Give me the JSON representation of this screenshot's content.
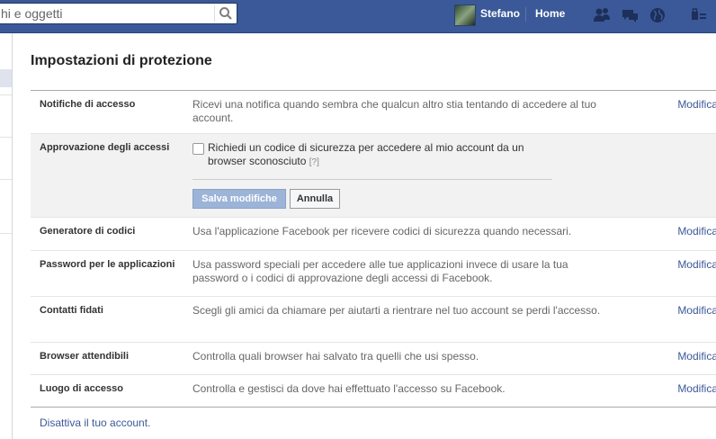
{
  "topbar": {
    "search_placeholder": "hi e oggetti",
    "user_name": "Stefano",
    "home_label": "Home",
    "icons": [
      "friend-requests-icon",
      "messages-icon",
      "notifications-globe-icon",
      "account-menu-icon"
    ]
  },
  "page": {
    "title": "Impostazioni di protezione",
    "rows": [
      {
        "label": "Notifiche di accesso",
        "description": "Ricevi una notifica quando sembra che qualcun altro stia tentando di accedere al tuo account.",
        "edit": "Modifica"
      },
      {
        "label": "Approvazione degli accessi",
        "checkbox_text": "Richiedi un codice di sicurezza per accedere al mio account da un browser sconosciuto",
        "help": "[?]",
        "save_button": "Salva modifiche",
        "cancel_button": "Annulla",
        "checked": false
      },
      {
        "label": "Generatore di codici",
        "description": "Usa l'applicazione Facebook per ricevere codici di sicurezza quando necessari.",
        "edit": "Modifica"
      },
      {
        "label": "Password per le applicazioni",
        "description": "Usa password speciali per accedere alle tue applicazioni invece di usare la tua password o i codici di approvazione degli accessi di Facebook.",
        "edit": "Modifica"
      },
      {
        "label": "Contatti fidati",
        "description": "Scegli gli amici da chiamare per aiutarti a rientrare nel tuo account se perdi l'accesso.",
        "edit": "Modifica"
      },
      {
        "label": "Browser attendibili",
        "description": "Controlla quali browser hai salvato tra quelli che usi spesso.",
        "edit": "Modifica"
      },
      {
        "label": "Luogo di accesso",
        "description": "Controlla e gestisci da dove hai effettuato l'accesso su Facebook.",
        "edit": "Modifica"
      }
    ],
    "deactivate_link": "Disattiva il tuo account."
  },
  "colors": {
    "brand": "#3b5998",
    "link": "#3b5998",
    "save_disabled": "#9cb4d8"
  }
}
